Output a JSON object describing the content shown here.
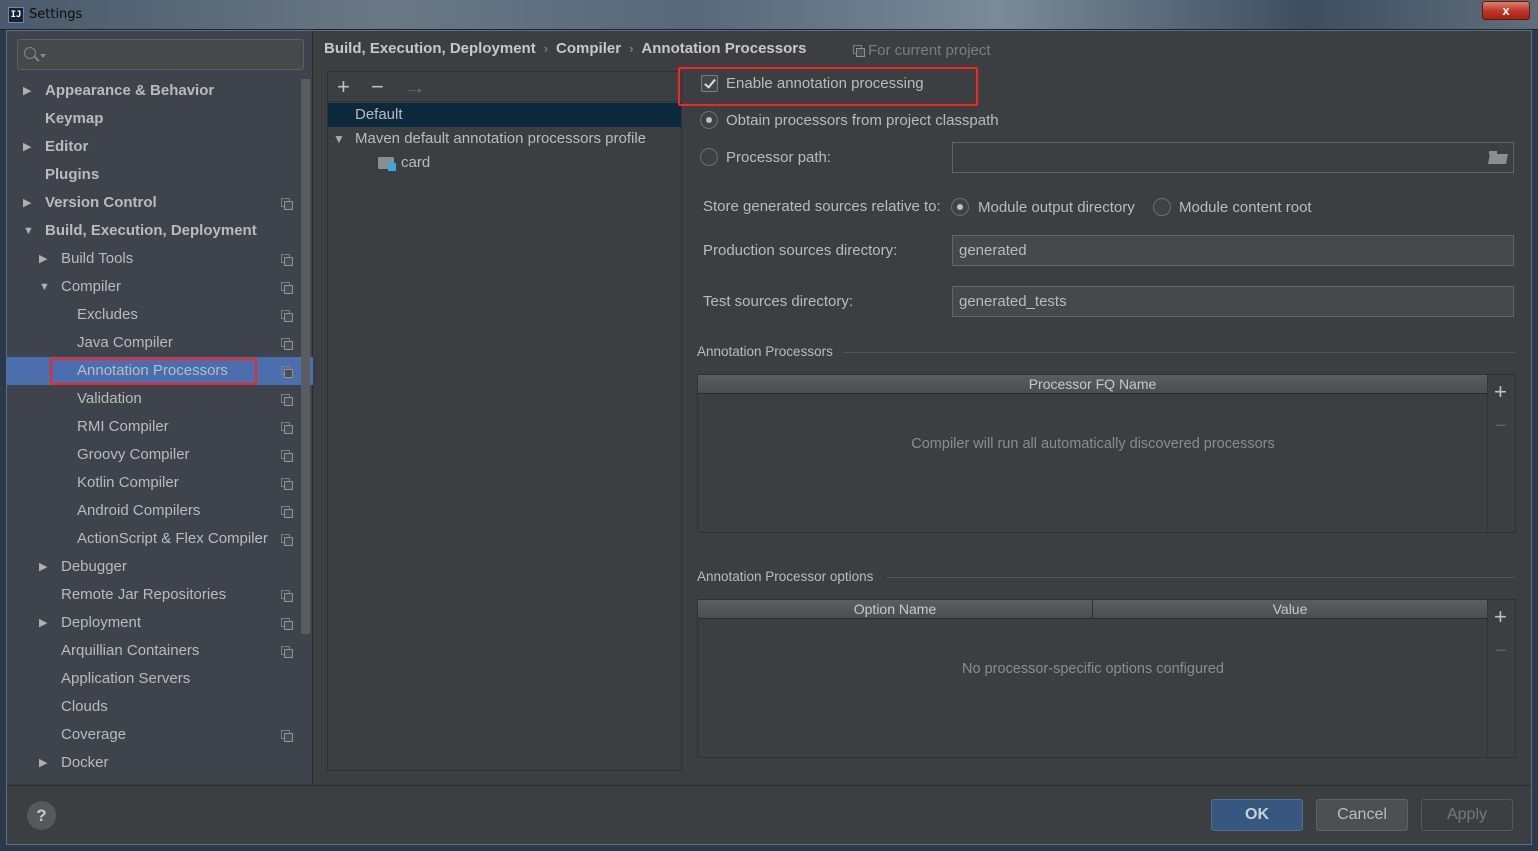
{
  "window": {
    "title": "Settings",
    "close_label": "x"
  },
  "search": {
    "placeholder": "",
    "value": ""
  },
  "sidebar": {
    "items": [
      {
        "label": "Appearance & Behavior",
        "level": 0,
        "arrow": "right",
        "bold": true,
        "project_scope": false
      },
      {
        "label": "Keymap",
        "level": 0,
        "arrow": "",
        "bold": true,
        "project_scope": false
      },
      {
        "label": "Editor",
        "level": 0,
        "arrow": "right",
        "bold": true,
        "project_scope": false
      },
      {
        "label": "Plugins",
        "level": 0,
        "arrow": "",
        "bold": true,
        "project_scope": false
      },
      {
        "label": "Version Control",
        "level": 0,
        "arrow": "right",
        "bold": true,
        "project_scope": true
      },
      {
        "label": "Build, Execution, Deployment",
        "level": 0,
        "arrow": "down",
        "bold": true,
        "project_scope": false
      },
      {
        "label": "Build Tools",
        "level": 1,
        "arrow": "right",
        "bold": false,
        "project_scope": true
      },
      {
        "label": "Compiler",
        "level": 1,
        "arrow": "down",
        "bold": false,
        "project_scope": true
      },
      {
        "label": "Excludes",
        "level": 2,
        "arrow": "",
        "bold": false,
        "project_scope": true
      },
      {
        "label": "Java Compiler",
        "level": 2,
        "arrow": "",
        "bold": false,
        "project_scope": true
      },
      {
        "label": "Annotation Processors",
        "level": 2,
        "arrow": "",
        "bold": false,
        "project_scope": true,
        "selected": true
      },
      {
        "label": "Validation",
        "level": 2,
        "arrow": "",
        "bold": false,
        "project_scope": true
      },
      {
        "label": "RMI Compiler",
        "level": 2,
        "arrow": "",
        "bold": false,
        "project_scope": true
      },
      {
        "label": "Groovy Compiler",
        "level": 2,
        "arrow": "",
        "bold": false,
        "project_scope": true
      },
      {
        "label": "Kotlin Compiler",
        "level": 2,
        "arrow": "",
        "bold": false,
        "project_scope": true
      },
      {
        "label": "Android Compilers",
        "level": 2,
        "arrow": "",
        "bold": false,
        "project_scope": true
      },
      {
        "label": "ActionScript & Flex Compiler",
        "level": 2,
        "arrow": "",
        "bold": false,
        "project_scope": true
      },
      {
        "label": "Debugger",
        "level": 1,
        "arrow": "right",
        "bold": false,
        "project_scope": false
      },
      {
        "label": "Remote Jar Repositories",
        "level": 1,
        "arrow": "",
        "bold": false,
        "project_scope": true
      },
      {
        "label": "Deployment",
        "level": 1,
        "arrow": "right",
        "bold": false,
        "project_scope": true
      },
      {
        "label": "Arquillian Containers",
        "level": 1,
        "arrow": "",
        "bold": false,
        "project_scope": true
      },
      {
        "label": "Application Servers",
        "level": 1,
        "arrow": "",
        "bold": false,
        "project_scope": false
      },
      {
        "label": "Clouds",
        "level": 1,
        "arrow": "",
        "bold": false,
        "project_scope": false
      },
      {
        "label": "Coverage",
        "level": 1,
        "arrow": "",
        "bold": false,
        "project_scope": true
      },
      {
        "label": "Docker",
        "level": 1,
        "arrow": "right",
        "bold": false,
        "project_scope": false
      }
    ]
  },
  "breadcrumb": {
    "items": [
      "Build, Execution, Deployment",
      "Compiler",
      "Annotation Processors"
    ],
    "separator": "›",
    "scope_note": "For current project"
  },
  "profiles": {
    "toolbar": {
      "add": "+",
      "remove": "−",
      "move": "→"
    },
    "items": [
      {
        "label": "Default",
        "selected": true
      },
      {
        "label": "Maven default annotation processors profile",
        "expanded": true
      },
      {
        "label": "card",
        "child": true
      }
    ]
  },
  "form": {
    "enable_processing": {
      "label": "Enable annotation processing",
      "checked": true
    },
    "obtain_classpath": {
      "label": "Obtain processors from project classpath",
      "selected": true
    },
    "processor_path": {
      "label": "Processor path:",
      "selected": false,
      "value": ""
    },
    "store_relative": {
      "label": "Store generated sources relative to:",
      "options": [
        {
          "label": "Module output directory",
          "selected": true
        },
        {
          "label": "Module content root",
          "selected": false
        }
      ]
    },
    "production_dir": {
      "label": "Production sources directory:",
      "value": "generated"
    },
    "test_dir": {
      "label": "Test sources directory:",
      "value": "generated_tests"
    }
  },
  "processors_table": {
    "group_title": "Annotation Processors",
    "columns": [
      "Processor FQ Name"
    ],
    "rows": [],
    "empty_text": "Compiler will run all automatically discovered processors",
    "add": "+",
    "remove": "−"
  },
  "options_table": {
    "group_title": "Annotation Processor options",
    "columns": [
      "Option Name",
      "Value"
    ],
    "rows": [],
    "empty_text": "No processor-specific options configured",
    "add": "+",
    "remove": "−"
  },
  "footer": {
    "help": "?",
    "ok": "OK",
    "cancel": "Cancel",
    "apply": "Apply"
  }
}
